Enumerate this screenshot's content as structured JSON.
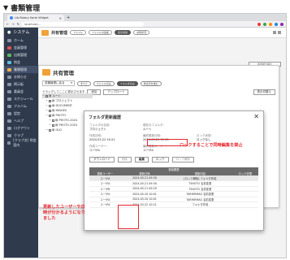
{
  "page": {
    "heading": "書類管理"
  },
  "browser": {
    "tab_title": "Lib-Rotary Karte Widget",
    "url": "localhost/…",
    "extension_colors": [
      "#e53935",
      "#43a047",
      "#fb8c00",
      "#1e88e5",
      "#8e24aa"
    ]
  },
  "sidebar": {
    "logo_text": "システム",
    "items": [
      {
        "label": "ホーム",
        "color": "#8a94a6"
      },
      {
        "label": "会員管理",
        "color": "#d9534f"
      },
      {
        "label": "出席管理",
        "color": "#5cb85c"
      },
      {
        "label": "例会",
        "color": "#5bc0de"
      },
      {
        "label": "書類管理",
        "color": "#f0ad4e"
      },
      {
        "label": "お知らせ",
        "color": "#8a94a6"
      },
      {
        "label": "掲示板",
        "color": "#8a94a6"
      },
      {
        "label": "委員会",
        "color": "#8a94a6"
      },
      {
        "label": "スケジュール",
        "color": "#8a94a6"
      },
      {
        "label": "アルバム",
        "color": "#8a94a6"
      },
      {
        "label": "設定",
        "color": "#8a94a6"
      },
      {
        "label": "ヘルプ",
        "color": "#8a94a6"
      },
      {
        "label": "ログアウト",
        "color": "#8a94a6"
      },
      {
        "label": "クラブ",
        "color": "#8a94a6"
      },
      {
        "label": "[クラブ名] 例会案内",
        "color": "#8a94a6"
      }
    ]
  },
  "topbar": {
    "title": "共有管理",
    "pills": [
      "ファイル",
      "ファイルの追加",
      "表示切替",
      "共有状況"
    ],
    "bg_button": "表示切り替え"
  },
  "doc_panel": {
    "title": "共有管理",
    "select_value": "書類管理に戻る",
    "pills": [
      "すべて",
      "ファイルのみ",
      "フォルダのみ",
      "非表示を含む"
    ],
    "breadcrumb_text": "ドラッグしてここに表示させます",
    "btn_add": "追加",
    "btn_upload": "アップロード",
    "btn_right": "表示切替え",
    "tree": [
      {
        "label": "ルート",
        "indent": 0,
        "selected": true
      },
      {
        "label": "プロジェクト",
        "indent": 1,
        "selected": false
      },
      {
        "label": "DOCUMENT",
        "indent": 1,
        "selected": false
      },
      {
        "label": "IMAGES",
        "indent": 1,
        "selected": false
      },
      {
        "label": "PHOTO",
        "indent": 1,
        "selected": false
      },
      {
        "label": "PHOTO-2024",
        "indent": 2,
        "selected": false
      },
      {
        "label": "PHOTO-2025",
        "indent": 2,
        "selected": false
      },
      {
        "label": "OLD",
        "indent": 1,
        "selected": false
      }
    ]
  },
  "dialog": {
    "title": "フォルダ更新履歴",
    "close_glyph": "✕",
    "fields": [
      {
        "label": "フォルダの名前：",
        "value": "プロジェクト"
      },
      {
        "label": "現在のフォルダ：",
        "value": "ルート"
      },
      {
        "label": "",
        "value": ""
      },
      {
        "label": "作成日時：",
        "value": "2024-03-22 10:21"
      },
      {
        "label": "最終更新日時：",
        "value": "2024-05-21 09:30"
      },
      {
        "label": "ロック状態：",
        "value": "ロックなし"
      },
      {
        "label": "作成ユーザー：",
        "value": "ユーザA"
      },
      {
        "label": "最終更新ユーザー：",
        "value": "ユーザA"
      },
      {
        "label": "",
        "value": ""
      }
    ],
    "buttons": [
      "ダウンロード",
      "削除",
      "編集",
      "ロック",
      "ロック解除"
    ],
    "table": {
      "caption": "更新履歴",
      "headers": [
        "更新ユーザー",
        "更新日時",
        "更新内容",
        "ロック状態"
      ],
      "rows": [
        [
          "ユーザA",
          "2024-05-21 09:30",
          "[ロック解除] フォルダ作成",
          ""
        ],
        [
          "ユーザA",
          "2024-05-21 09:30",
          "TSHOTO 名前変更",
          ""
        ],
        [
          "ユーザB",
          "2024-05-21 09:29",
          "TSHOTO 名前変更",
          ""
        ],
        [
          "ユーザA",
          "2024-05-20 10:01",
          "TARHIRMAG 名前変更",
          ""
        ],
        [
          "ユーザA",
          "2024-05-20 10:01",
          "TARHIRMAG 名前変更",
          ""
        ],
        [
          "ユーザA",
          "2024-03-22 10:21",
          "フォルダ作成",
          ""
        ]
      ]
    }
  },
  "annotations": {
    "right": "ロックすることで同時編集を禁止",
    "left": "更新したユーザーや日時が分かるようになりました"
  }
}
